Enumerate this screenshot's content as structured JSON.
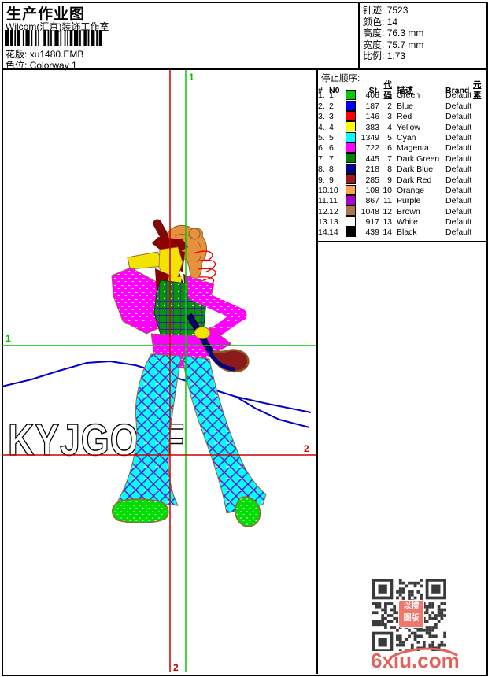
{
  "page": {
    "title": "生产作业图",
    "subtitle": "Wilcom(汇京)装饰工作室"
  },
  "header": {
    "pattern_label": "花版:",
    "pattern_value": "xu1480.EMB",
    "colorway_label": "色位:",
    "colorway_value": "Colorway 1",
    "stats": [
      {
        "label": "针迹:",
        "value": "7523"
      },
      {
        "label": "颜色:",
        "value": "14"
      },
      {
        "label": "高度:",
        "value": "76.3 mm"
      },
      {
        "label": "宽度:",
        "value": "75.7 mm"
      },
      {
        "label": "比例:",
        "value": "1.73"
      }
    ]
  },
  "color_table": {
    "title": "停止顺序:",
    "columns": [
      "#",
      "N0",
      "St.",
      "代码",
      "描述",
      "Brand",
      "元素"
    ],
    "rows": [
      {
        "seq": "1.",
        "n0": "1",
        "color": "#00CC00",
        "st": "406",
        "code": "1",
        "desc": "Green",
        "brand": "Default",
        "element": ""
      },
      {
        "seq": "2.",
        "n0": "2",
        "color": "#0000FF",
        "st": "187",
        "code": "2",
        "desc": "Blue",
        "brand": "Default",
        "element": ""
      },
      {
        "seq": "3.",
        "n0": "3",
        "color": "#FF0000",
        "st": "146",
        "code": "3",
        "desc": "Red",
        "brand": "Default",
        "element": ""
      },
      {
        "seq": "4.",
        "n0": "4",
        "color": "#FFFF00",
        "st": "383",
        "code": "4",
        "desc": "Yellow",
        "brand": "Default",
        "element": ""
      },
      {
        "seq": "5.",
        "n0": "5",
        "color": "#00FFFF",
        "st": "1349",
        "code": "5",
        "desc": "Cyan",
        "brand": "Default",
        "element": ""
      },
      {
        "seq": "6.",
        "n0": "6",
        "color": "#FF00FF",
        "st": "722",
        "code": "6",
        "desc": "Magenta",
        "brand": "Default",
        "element": ""
      },
      {
        "seq": "7.",
        "n0": "7",
        "color": "#008000",
        "st": "445",
        "code": "7",
        "desc": "Dark Green",
        "brand": "Default",
        "element": ""
      },
      {
        "seq": "8.",
        "n0": "8",
        "color": "#000099",
        "st": "218",
        "code": "8",
        "desc": "Dark Blue",
        "brand": "Default",
        "element": ""
      },
      {
        "seq": "9.",
        "n0": "9",
        "color": "#A51616",
        "st": "285",
        "code": "9",
        "desc": "Dark Red",
        "brand": "Default",
        "element": ""
      },
      {
        "seq": "10.",
        "n0": "10",
        "color": "#FFA64D",
        "st": "108",
        "code": "10",
        "desc": "Orange",
        "brand": "Default",
        "element": ""
      },
      {
        "seq": "11.",
        "n0": "11",
        "color": "#AA00CC",
        "st": "867",
        "code": "11",
        "desc": "Purple",
        "brand": "Default",
        "element": ""
      },
      {
        "seq": "12.",
        "n0": "12",
        "color": "#AA7748",
        "st": "1048",
        "code": "12",
        "desc": "Brown",
        "brand": "Default",
        "element": ""
      },
      {
        "seq": "13.",
        "n0": "13",
        "color": "#FFFFFF",
        "st": "917",
        "code": "13",
        "desc": "White",
        "brand": "Default",
        "element": ""
      },
      {
        "seq": "14.",
        "n0": "14",
        "color": "#000000",
        "st": "439",
        "code": "14",
        "desc": "Black",
        "brand": "Default",
        "element": ""
      }
    ]
  },
  "design": {
    "watermark_text": "KYJGOLF",
    "guide_labels": {
      "start": "1",
      "end": "2"
    },
    "colors": {
      "guide_start": "#00CC00",
      "guide_end": "#CC0000",
      "horizon_line": "#0000CC"
    }
  },
  "footer": {
    "qr_logo_line1": "以搜",
    "qr_logo_line2": "图版",
    "site": "6xiu.com"
  }
}
